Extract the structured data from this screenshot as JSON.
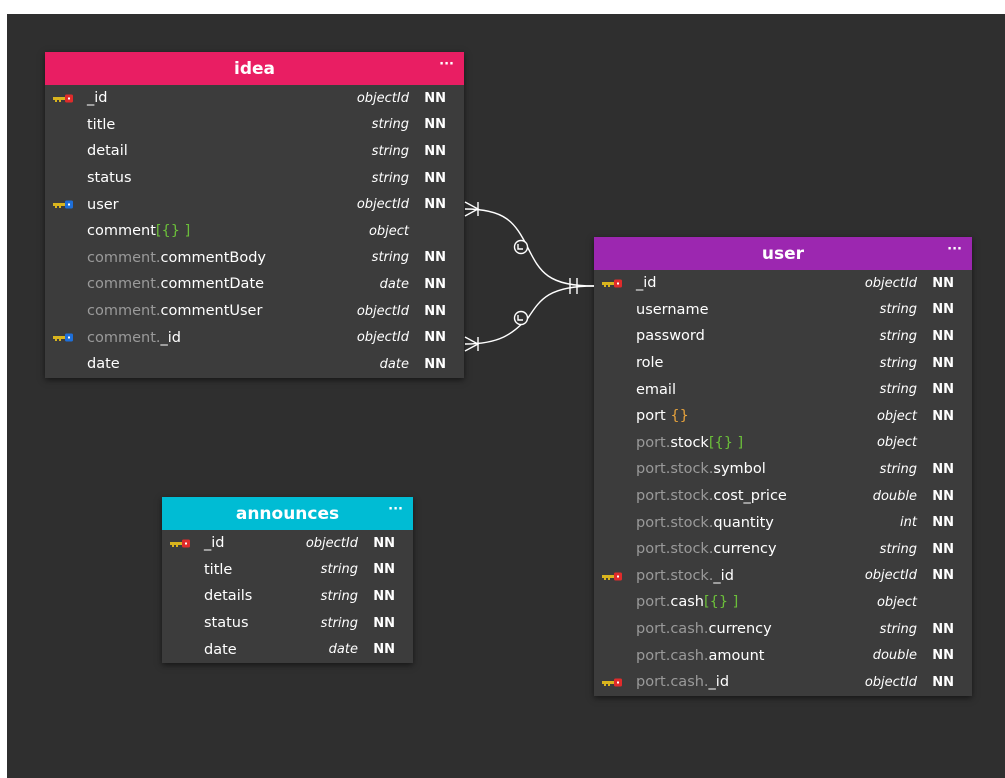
{
  "colors": {
    "idea_header": "#e91e63",
    "user_header": "#9c27b0",
    "announces_header": "#00bcd4",
    "canvas": "#2f2f2f",
    "table_body": "#3c3c3c",
    "pk_key": "#d9b41e",
    "fk_key": "#1e6fd9"
  },
  "tables": {
    "idea": {
      "name": "idea",
      "menu": "···",
      "fields": [
        {
          "key": "pk",
          "prefix": "",
          "name": "_id",
          "bracket": "",
          "type": "objectId",
          "nn": "NN"
        },
        {
          "key": "",
          "prefix": "",
          "name": "title",
          "bracket": "",
          "type": "string",
          "nn": "NN"
        },
        {
          "key": "",
          "prefix": "",
          "name": "detail",
          "bracket": "",
          "type": "string",
          "nn": "NN"
        },
        {
          "key": "",
          "prefix": "",
          "name": "status",
          "bracket": "",
          "type": "string",
          "nn": "NN"
        },
        {
          "key": "fk",
          "prefix": "",
          "name": "user",
          "bracket": "",
          "type": "objectId",
          "nn": "NN"
        },
        {
          "key": "",
          "prefix": "",
          "name": "comment",
          "bracket": "[{} ]",
          "type": "object",
          "nn": ""
        },
        {
          "key": "",
          "prefix": "comment.",
          "name": "commentBody",
          "bracket": "",
          "type": "string",
          "nn": "NN"
        },
        {
          "key": "",
          "prefix": "comment.",
          "name": "commentDate",
          "bracket": "",
          "type": "date",
          "nn": "NN"
        },
        {
          "key": "",
          "prefix": "comment.",
          "name": "commentUser",
          "bracket": "",
          "type": "objectId",
          "nn": "NN"
        },
        {
          "key": "fk",
          "prefix": "comment.",
          "name": "_id",
          "bracket": "",
          "type": "objectId",
          "nn": "NN"
        },
        {
          "key": "",
          "prefix": "",
          "name": "date",
          "bracket": "",
          "type": "date",
          "nn": "NN"
        }
      ]
    },
    "user": {
      "name": "user",
      "menu": "···",
      "fields": [
        {
          "key": "pk",
          "prefix": "",
          "name": "_id",
          "bracket": "",
          "type": "objectId",
          "nn": "NN"
        },
        {
          "key": "",
          "prefix": "",
          "name": "username",
          "bracket": "",
          "type": "string",
          "nn": "NN"
        },
        {
          "key": "",
          "prefix": "",
          "name": "password",
          "bracket": "",
          "type": "string",
          "nn": "NN"
        },
        {
          "key": "",
          "prefix": "",
          "name": "role",
          "bracket": "",
          "type": "string",
          "nn": "NN"
        },
        {
          "key": "",
          "prefix": "",
          "name": "email",
          "bracket": "",
          "type": "string",
          "nn": "NN"
        },
        {
          "key": "",
          "prefix": "",
          "name": "port",
          "bracket2": "{}",
          "bracket": "",
          "type": "object",
          "nn": "NN"
        },
        {
          "key": "",
          "prefix": "port.",
          "name": "stock",
          "bracket": "[{} ]",
          "type": "object",
          "nn": ""
        },
        {
          "key": "",
          "prefix": "port.stock.",
          "name": "symbol",
          "bracket": "",
          "type": "string",
          "nn": "NN"
        },
        {
          "key": "",
          "prefix": "port.stock.",
          "name": "cost_price",
          "bracket": "",
          "type": "double",
          "nn": "NN"
        },
        {
          "key": "",
          "prefix": "port.stock.",
          "name": "quantity",
          "bracket": "",
          "type": "int",
          "nn": "NN"
        },
        {
          "key": "",
          "prefix": "port.stock.",
          "name": "currency",
          "bracket": "",
          "type": "string",
          "nn": "NN"
        },
        {
          "key": "pk",
          "prefix": "port.stock.",
          "name": "_id",
          "bracket": "",
          "type": "objectId",
          "nn": "NN"
        },
        {
          "key": "",
          "prefix": "port.",
          "name": "cash",
          "bracket": "[{} ]",
          "type": "object",
          "nn": ""
        },
        {
          "key": "",
          "prefix": "port.cash.",
          "name": "currency",
          "bracket": "",
          "type": "string",
          "nn": "NN"
        },
        {
          "key": "",
          "prefix": "port.cash.",
          "name": "amount",
          "bracket": "",
          "type": "double",
          "nn": "NN"
        },
        {
          "key": "pk",
          "prefix": "port.cash.",
          "name": "_id",
          "bracket": "",
          "type": "objectId",
          "nn": "NN"
        }
      ]
    },
    "announces": {
      "name": "announces",
      "menu": "···",
      "fields": [
        {
          "key": "pk",
          "prefix": "",
          "name": "_id",
          "bracket": "",
          "type": "objectId",
          "nn": "NN"
        },
        {
          "key": "",
          "prefix": "",
          "name": "title",
          "bracket": "",
          "type": "string",
          "nn": "NN"
        },
        {
          "key": "",
          "prefix": "",
          "name": "details",
          "bracket": "",
          "type": "string",
          "nn": "NN"
        },
        {
          "key": "",
          "prefix": "",
          "name": "status",
          "bracket": "",
          "type": "string",
          "nn": "NN"
        },
        {
          "key": "",
          "prefix": "",
          "name": "date",
          "bracket": "",
          "type": "date",
          "nn": "NN"
        }
      ]
    }
  },
  "relations": [
    {
      "from": "idea.user",
      "to": "user._id",
      "from_card": "many",
      "to_card": "one"
    },
    {
      "from": "idea.comment._id",
      "to": "user._id",
      "from_card": "many",
      "to_card": "one"
    }
  ]
}
